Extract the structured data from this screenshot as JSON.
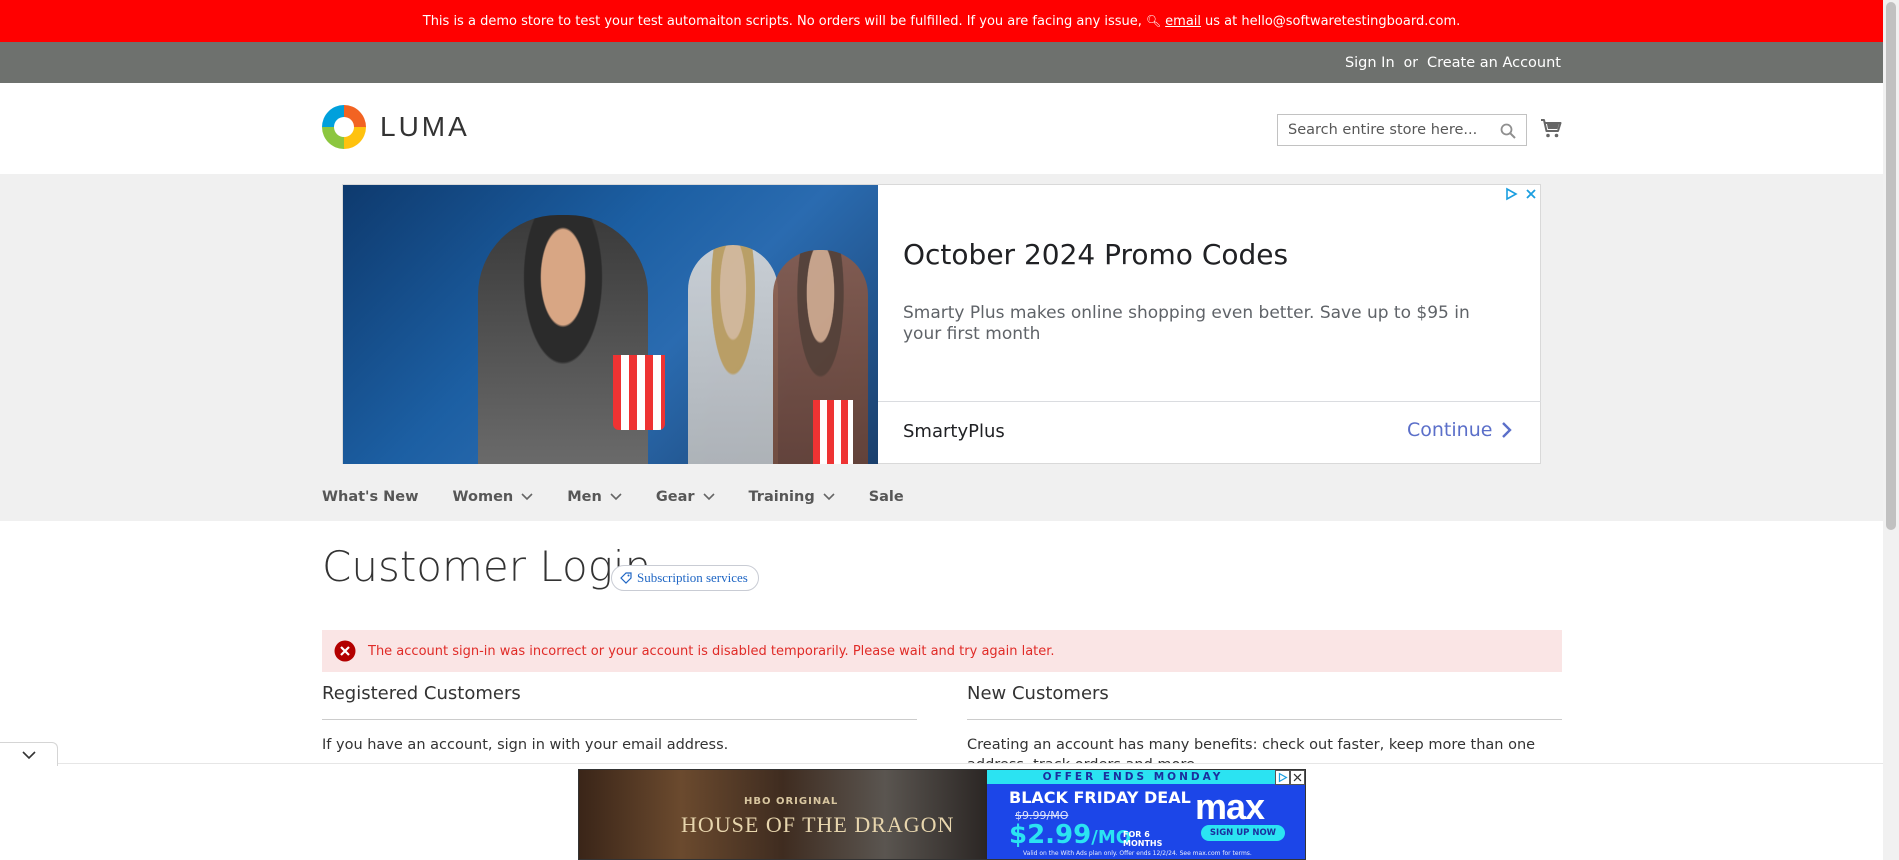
{
  "notice": {
    "text_before": "This is a demo store to test your test automaiton scripts. No orders will be fulfilled. If you are facing any issue,",
    "email_link": "email",
    "text_after": "us at hello@softwaretestingboard.com."
  },
  "header_links": {
    "sign_in": "Sign In",
    "or": "or",
    "create_account": "Create an Account"
  },
  "logo": {
    "text": "LUMA"
  },
  "search": {
    "placeholder": "Search entire store here..."
  },
  "ad": {
    "title": "October 2024 Promo Codes",
    "body": "Smarty Plus makes online shopping even better. Save up to $95 in your first month",
    "brand": "SmartyPlus",
    "cta": "Continue"
  },
  "nav": [
    {
      "label": "What's New",
      "has_dropdown": false
    },
    {
      "label": "Women",
      "has_dropdown": true
    },
    {
      "label": "Men",
      "has_dropdown": true
    },
    {
      "label": "Gear",
      "has_dropdown": true
    },
    {
      "label": "Training",
      "has_dropdown": true
    },
    {
      "label": "Sale",
      "has_dropdown": false
    }
  ],
  "page": {
    "title": "Customer Login",
    "badge": "Subscription services",
    "error": "The account sign-in was incorrect or your account is disabled temporarily. Please wait and try again later."
  },
  "registered": {
    "title": "Registered Customers",
    "text": "If you have an account, sign in with your email address."
  },
  "new_customers": {
    "title": "New Customers",
    "text": "Creating an account has many benefits: check out faster, keep more than one address, track orders and more."
  },
  "banner_ad": {
    "offer_strip": "OFFER ENDS MONDAY",
    "hbo": "HBO ORIGINAL",
    "show": "HOUSE OF THE DRAGON",
    "deal": "BLACK FRIDAY DEAL",
    "old_price": "$9.99/MO",
    "price": "$2.99",
    "per": "/MO",
    "for_months": "FOR 6 MONTHS",
    "brand": "max",
    "cta": "SIGN UP NOW",
    "fine_print": "Valid on the With Ads plan only. Offer ends 12/2/24. See max.com for terms."
  },
  "colors": {
    "notice_bg": "#ff0000",
    "panel_bg": "#6e716e",
    "error_text": "#e02b27",
    "error_bg": "#fae5e5",
    "ad_link": "#5b6fc9"
  }
}
